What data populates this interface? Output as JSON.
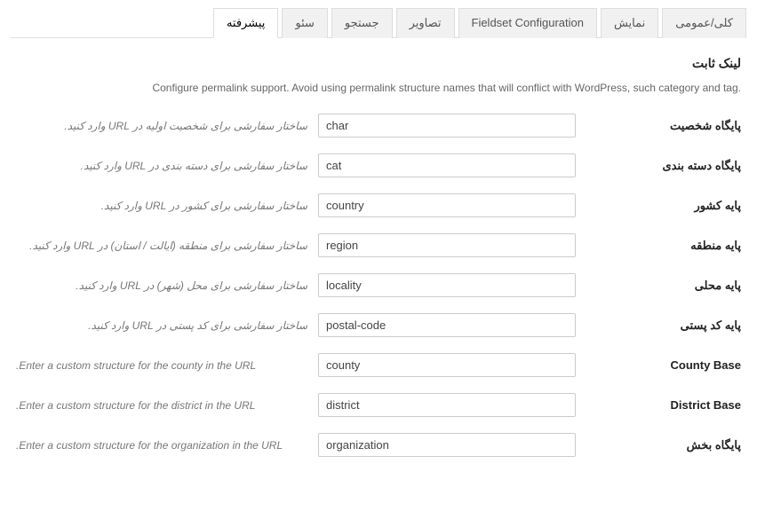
{
  "tabs": [
    {
      "label": "کلی/عمومی",
      "active": false
    },
    {
      "label": "نمایش",
      "active": false
    },
    {
      "label": "Fieldset Configuration",
      "active": false
    },
    {
      "label": "تصاویر",
      "active": false
    },
    {
      "label": "جستجو",
      "active": false
    },
    {
      "label": "سئو",
      "active": false
    },
    {
      "label": "پیشرفته",
      "active": true
    }
  ],
  "section": {
    "title": "لینک ثابت",
    "description": ".Configure permalink support. Avoid using permalink structure names that will conflict with WordPress, such category and tag"
  },
  "fields": [
    {
      "label": "پایگاه شخصیت",
      "value": "char",
      "hint": "ساختار سفارشی برای شخصیت اولیه در URL وارد کنید.",
      "rtl_hint": true
    },
    {
      "label": "پایگاه دسته بندی",
      "value": "cat",
      "hint": "ساختار سفارشی برای دسته بندی در URL وارد کنید.",
      "rtl_hint": true
    },
    {
      "label": "پایه کشور",
      "value": "country",
      "hint": "ساختار سفارشی برای کشور در URL وارد کنید.",
      "rtl_hint": true
    },
    {
      "label": "پایه منطقه",
      "value": "region",
      "hint": "ساختار سفارشی برای منطقه (ایالت / استان) در URL وارد کنید.",
      "rtl_hint": true
    },
    {
      "label": "پایه محلی",
      "value": "locality",
      "hint": "ساختار سفارشی برای محل (شهر) در URL وارد کنید.",
      "rtl_hint": true
    },
    {
      "label": "پایه کد پستی",
      "value": "postal-code",
      "hint": "ساختار سفارشی برای کد پستی در URL وارد کنید.",
      "rtl_hint": true
    },
    {
      "label": "County Base",
      "value": "county",
      "hint": ".Enter a custom structure for the county in the URL",
      "rtl_hint": false
    },
    {
      "label": "District Base",
      "value": "district",
      "hint": ".Enter a custom structure for the district in the URL",
      "rtl_hint": false
    },
    {
      "label": "پایگاه بخش",
      "value": "organization",
      "hint": ".Enter a custom structure for the organization in the URL",
      "rtl_hint": false
    }
  ]
}
